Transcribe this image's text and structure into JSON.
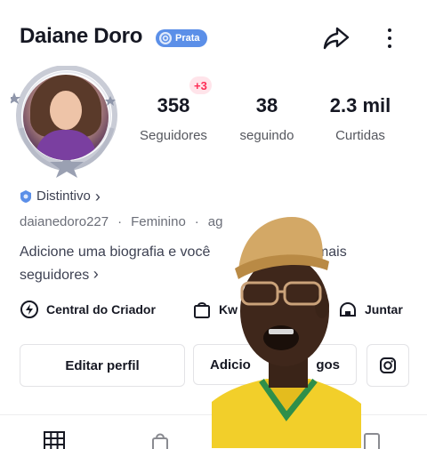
{
  "header": {
    "name": "Daiane Doro",
    "level_badge": "Prata",
    "icons": {
      "share": "share-arrow-icon",
      "more": "more-vertical-icon"
    }
  },
  "stats": {
    "followers_new": "+3",
    "items": [
      {
        "value": "358",
        "label": "Seguidores"
      },
      {
        "value": "38",
        "label": "seguindo"
      },
      {
        "value": "2.3 mil",
        "label": "Curtidas"
      }
    ]
  },
  "badge": {
    "label": "Distintivo",
    "chevron": "›"
  },
  "meta": {
    "username": "daianedoro227",
    "gender": "Feminino",
    "extra": "ag"
  },
  "bio": {
    "text_start": "Adicione uma biografia e você",
    "text_end": "ar mais",
    "line2": "seguidores",
    "chevron": "›"
  },
  "links": [
    {
      "label": "Central do Criador",
      "icon": "creator-center-icon"
    },
    {
      "label": "Kw",
      "icon": "shopping-bag-icon"
    },
    {
      "label": "Juntar",
      "icon": "live-join-icon"
    }
  ],
  "buttons": {
    "edit_profile": "Editar perfil",
    "add_friends_start": "Adicio",
    "add_friends_end": "gos",
    "instagram_icon": "instagram-icon"
  },
  "tabs": {
    "icons": [
      "grid-icon",
      "lock-icon",
      "repost-icon",
      "bookmark-icon"
    ]
  },
  "colors": {
    "accent_red": "#fe2c55",
    "badge_blue": "#5b8fe8",
    "text": "#161823",
    "muted": "#6b6e78"
  }
}
